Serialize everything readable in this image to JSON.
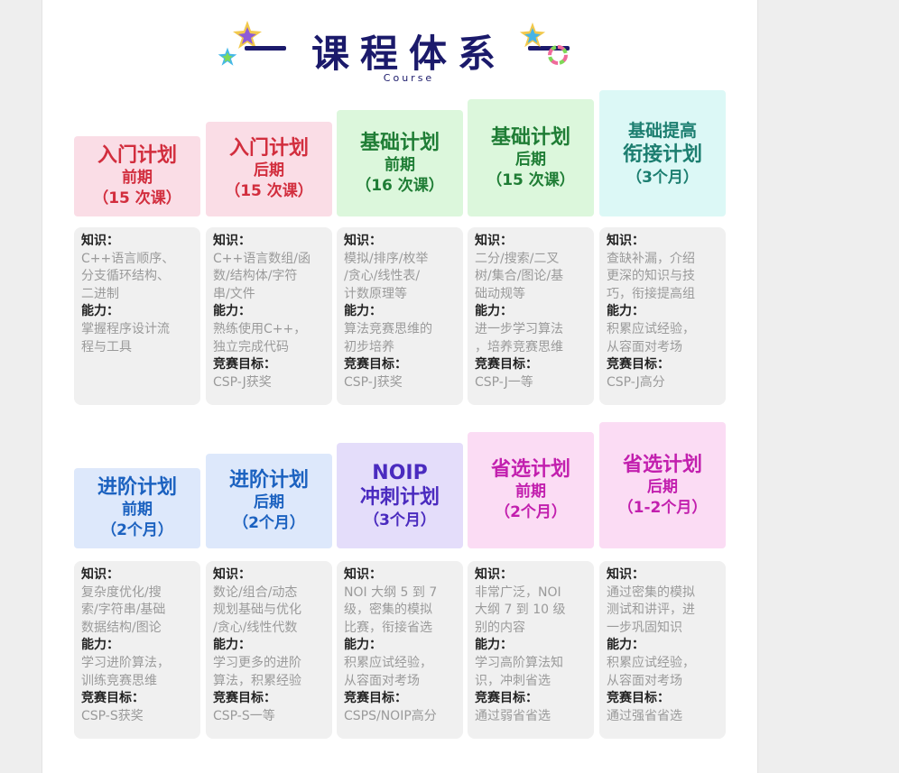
{
  "header": {
    "title": "课程体系",
    "subtitle": "Course",
    "title_color": "#1b1a6b"
  },
  "labels": {
    "knowledge": "知识：",
    "ability": "能力：",
    "goal": "竞赛目标："
  },
  "rows": [
    {
      "columns": [
        {
          "tab": {
            "line1": "入门计划",
            "line2": "前期",
            "line3": "（15 次课）",
            "bg": "#fadde6",
            "color": "#d22e3e"
          },
          "card": {
            "knowledge": [
              "C++语言顺序、",
              "分支循环结构、",
              "二进制"
            ],
            "ability": [
              "掌握程序设计流",
              "程与工具"
            ],
            "goal": []
          }
        },
        {
          "tab": {
            "line1": "入门计划",
            "line2": "后期",
            "line3": "（15 次课）",
            "bg": "#fadde6",
            "color": "#d22e3e"
          },
          "card": {
            "knowledge": [
              "C++语言数组/函",
              "数/结构体/字符",
              "串/文件"
            ],
            "ability": [
              "熟练使用C++，",
              "独立完成代码"
            ],
            "goal": [
              "CSP-J获奖"
            ]
          }
        },
        {
          "tab": {
            "line1": "基础计划",
            "line2": "前期",
            "line3": "（16 次课）",
            "bg": "#dcf7dc",
            "color": "#1f7d35"
          },
          "card": {
            "knowledge": [
              "模拟/排序/枚举",
              "/贪心/线性表/",
              "计数原理等"
            ],
            "ability": [
              "算法竞赛思维的",
              "初步培养"
            ],
            "goal": [
              "CSP-J获奖"
            ]
          }
        },
        {
          "tab": {
            "line1": "基础计划",
            "line2": "后期",
            "line3": "（15 次课）",
            "bg": "#dcf7dc",
            "color": "#1f7d35"
          },
          "card": {
            "knowledge": [
              "二分/搜索/二叉",
              "树/集合/图论/基",
              "础动规等"
            ],
            "ability": [
              "进一步学习算法",
              "，培养竞赛思维"
            ],
            "goal": [
              "CSP-J一等"
            ]
          }
        },
        {
          "tab": {
            "line1": "基础提高",
            "line2": "衔接计划",
            "line3": "（3个月）",
            "bg": "#dcf8f6",
            "color": "#1c7e70"
          },
          "card": {
            "knowledge": [
              "查缺补漏，介绍",
              "更深的知识与技",
              "巧，衔接提高组"
            ],
            "ability": [
              "积累应试经验，",
              "从容面对考场"
            ],
            "goal": [
              "CSP-J高分"
            ]
          }
        }
      ]
    },
    {
      "columns": [
        {
          "tab": {
            "line1": "进阶计划",
            "line2": "前期",
            "line3": "（2个月）",
            "bg": "#dde8fb",
            "color": "#1c62c0"
          },
          "card": {
            "knowledge": [
              "复杂度优化/搜",
              "索/字符串/基础",
              "数据结构/图论"
            ],
            "ability": [
              "学习进阶算法，",
              "训练竞赛思维"
            ],
            "goal": [
              "CSP-S获奖"
            ]
          }
        },
        {
          "tab": {
            "line1": "进阶计划",
            "line2": "后期",
            "line3": "（2个月）",
            "bg": "#dde8fb",
            "color": "#1c62c0"
          },
          "card": {
            "knowledge": [
              "数论/组合/动态",
              "规划基础与优化",
              "/贪心/线性代数"
            ],
            "ability": [
              "学习更多的进阶",
              "算法，积累经验"
            ],
            "goal": [
              "CSP-S一等"
            ]
          }
        },
        {
          "tab": {
            "line1": "NOIP",
            "line2": "冲刺计划",
            "line3": "（3个月）",
            "bg": "#e4ddfa",
            "color": "#4a2bbf"
          },
          "card": {
            "knowledge": [
              "NOI 大纲 5 到 7",
              "级，密集的模拟",
              "比赛，衔接省选"
            ],
            "ability": [
              "积累应试经验，",
              "从容面对考场"
            ],
            "goal": [
              "CSPS/NOIP高分"
            ]
          }
        },
        {
          "tab": {
            "line1": "省选计划",
            "line2": "前期",
            "line3": "（2个月）",
            "bg": "#fbdcf4",
            "color": "#c21fae"
          },
          "card": {
            "knowledge": [
              "非常广泛，NOI",
              "大纲 7 到 10 级",
              "别的内容"
            ],
            "ability": [
              "学习高阶算法知",
              "识，冲刺省选"
            ],
            "goal": [
              "通过弱省省选"
            ]
          }
        },
        {
          "tab": {
            "line1": "省选计划",
            "line2": "后期",
            "line3": "（1-2个月）",
            "bg": "#fbdcf4",
            "color": "#c21fae"
          },
          "card": {
            "knowledge": [
              "通过密集的模拟",
              "测试和讲评，进",
              "一步巩固知识"
            ],
            "ability": [
              "积累应试经验，",
              "从容面对考场"
            ],
            "goal": [
              "通过强省省选"
            ]
          }
        }
      ]
    }
  ]
}
